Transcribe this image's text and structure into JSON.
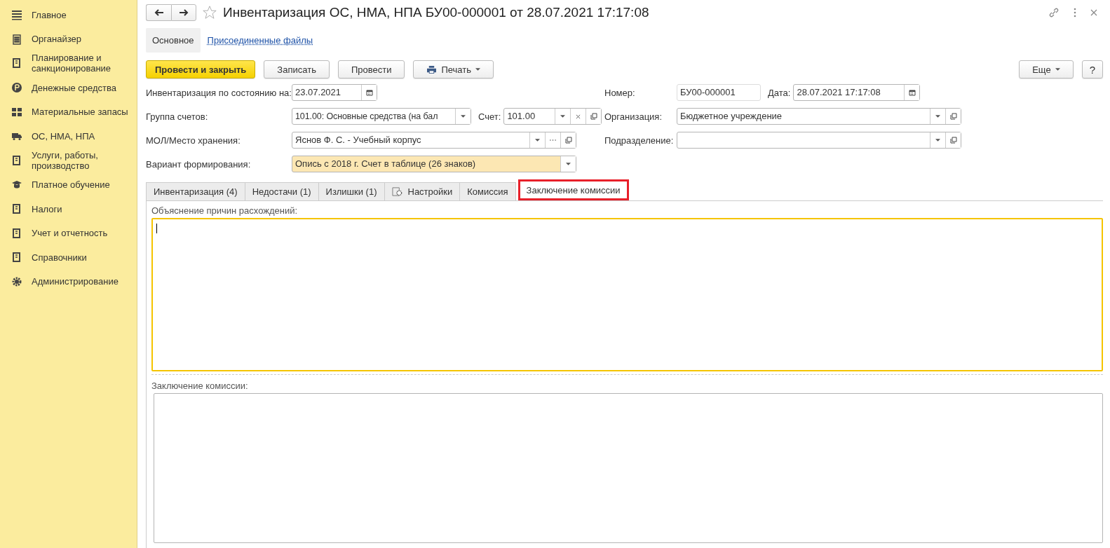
{
  "sidebar": {
    "items": [
      {
        "label": "Главное"
      },
      {
        "label": "Органайзер"
      },
      {
        "label": "Планирование и санкционирование"
      },
      {
        "label": "Денежные средства"
      },
      {
        "label": "Материальные запасы"
      },
      {
        "label": "ОС, НМА, НПА"
      },
      {
        "label": "Услуги, работы, производство"
      },
      {
        "label": "Платное обучение"
      },
      {
        "label": "Налоги"
      },
      {
        "label": "Учет и отчетность"
      },
      {
        "label": "Справочники"
      },
      {
        "label": "Администрирование"
      }
    ]
  },
  "window": {
    "title": "Инвентаризация ОС, НМА, НПА БУ00-000001 от 28.07.2021 17:17:08",
    "favorite": false
  },
  "sections": [
    {
      "label": "Основное",
      "selected": true
    },
    {
      "label": "Присоединенные файлы",
      "selected": false
    }
  ],
  "toolbar": {
    "buttons": [
      {
        "label": "Провести и закрыть",
        "kind": "primary"
      },
      {
        "label": "Записать",
        "kind": "plain"
      },
      {
        "label": "Провести",
        "kind": "plain"
      },
      {
        "label": "Печать",
        "kind": "print"
      }
    ],
    "more": "Еще",
    "help": "?"
  },
  "form": {
    "date_label": "Инвентаризация по состоянию на:",
    "date_value": "23.07.2021",
    "number_label": "Номер:",
    "number_value": "БУ00-000001",
    "docdate_label": "Дата:",
    "docdate_value": "28.07.2021 17:17:08",
    "group_label": "Группа счетов:",
    "group_value": "101.00: Основные средства (на бал",
    "account_label": "Счет:",
    "account_value": "101.00",
    "org_label": "Организация:",
    "org_value": "Бюджетное учреждение",
    "mol_label": "МОЛ/Место хранения:",
    "mol_value": "Яснов Ф. С. - Учебный корпус",
    "division_label": "Подразделение:",
    "variant_label": "Вариант формирования:",
    "variant_value": "Опись с 2018 г. Счет в таблице (26 знаков)"
  },
  "tabs": [
    {
      "label": "Инвентаризация (4)",
      "selected": false,
      "highlighted": false
    },
    {
      "label": "Недостачи (1)",
      "selected": false,
      "highlighted": false
    },
    {
      "label": "Излишки (1)",
      "selected": false,
      "highlighted": false
    },
    {
      "label": "Настройки",
      "selected": false,
      "highlighted": false,
      "kind": "settings"
    },
    {
      "label": "Комиссия",
      "selected": false,
      "highlighted": false
    },
    {
      "label": "Заключение комиссии",
      "selected": true,
      "highlighted": true
    }
  ],
  "memos": [
    {
      "label": "Объяснение причин расхождений:",
      "focused": true
    },
    {
      "label": "Заключение комиссии:",
      "focused": false
    }
  ]
}
